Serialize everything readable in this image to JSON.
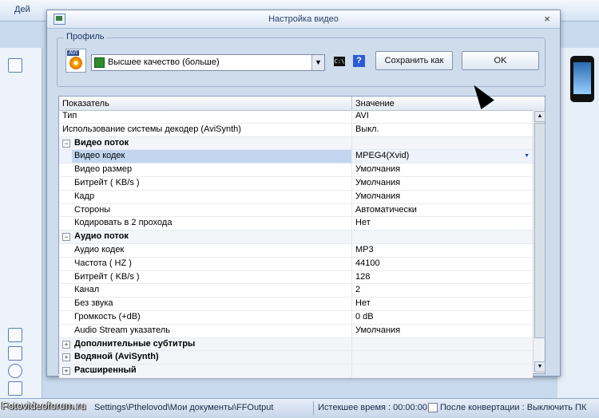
{
  "background": {
    "title_fragment": "Дей",
    "status_path": "Settings\\Pthelovod\\Мои документы\\FFOutput",
    "elapsed_label": "Истекшее время : 00:00:00",
    "after_conversion_label": "После конвертации : Выключить ПК",
    "watermark": "Fotovideoforum.ru"
  },
  "dialog": {
    "title": "Настройка видео",
    "close_glyph": "×",
    "profile": {
      "legend": "Профиль",
      "avi_label": "AVI",
      "selected": "Высшее качество (больше)",
      "cmd_label": "C:\\",
      "help_label": "?",
      "save_as_label": "Сохранить как",
      "ok_label": "OK"
    },
    "grid": {
      "col_name": "Показатель",
      "col_value": "Значение",
      "rows": [
        {
          "type": "prop",
          "name": "Тип",
          "value": "AVI"
        },
        {
          "type": "prop",
          "name": "Использование системы декодер (AviSynth)",
          "value": "Выкл."
        },
        {
          "type": "cat",
          "expander": "−",
          "name": "Видео поток"
        },
        {
          "type": "child",
          "name": "Видео кодек",
          "value": "MPEG4(Xvid)",
          "selected": true
        },
        {
          "type": "child",
          "name": "Видео размер",
          "value": "Умолчания"
        },
        {
          "type": "child",
          "name": "Битрейт ( KB/s )",
          "value": "Умолчания"
        },
        {
          "type": "child",
          "name": "Кадр",
          "value": "Умолчания"
        },
        {
          "type": "child",
          "name": "Стороны",
          "value": "Автоматически"
        },
        {
          "type": "child",
          "name": "Кодировать в 2 прохода",
          "value": "Нет"
        },
        {
          "type": "cat",
          "expander": "−",
          "name": "Аудио поток"
        },
        {
          "type": "child",
          "name": "Аудио кодек",
          "value": "MP3"
        },
        {
          "type": "child",
          "name": "Частота ( HZ )",
          "value": "44100"
        },
        {
          "type": "child",
          "name": "Битрейт ( KB/s )",
          "value": "128"
        },
        {
          "type": "child",
          "name": "Канал",
          "value": "2"
        },
        {
          "type": "child",
          "name": "Без звука",
          "value": "Нет"
        },
        {
          "type": "child",
          "name": "Громкость (+dB)",
          "value": "0 dB"
        },
        {
          "type": "child",
          "name": "Audio Stream указатель",
          "value": "Умолчания"
        },
        {
          "type": "cat",
          "expander": "+",
          "name": "Дополнительные субтитры"
        },
        {
          "type": "cat",
          "expander": "+",
          "name": "Водяной (AviSynth)"
        },
        {
          "type": "cat",
          "expander": "+",
          "name": "Расширенный"
        }
      ]
    }
  }
}
